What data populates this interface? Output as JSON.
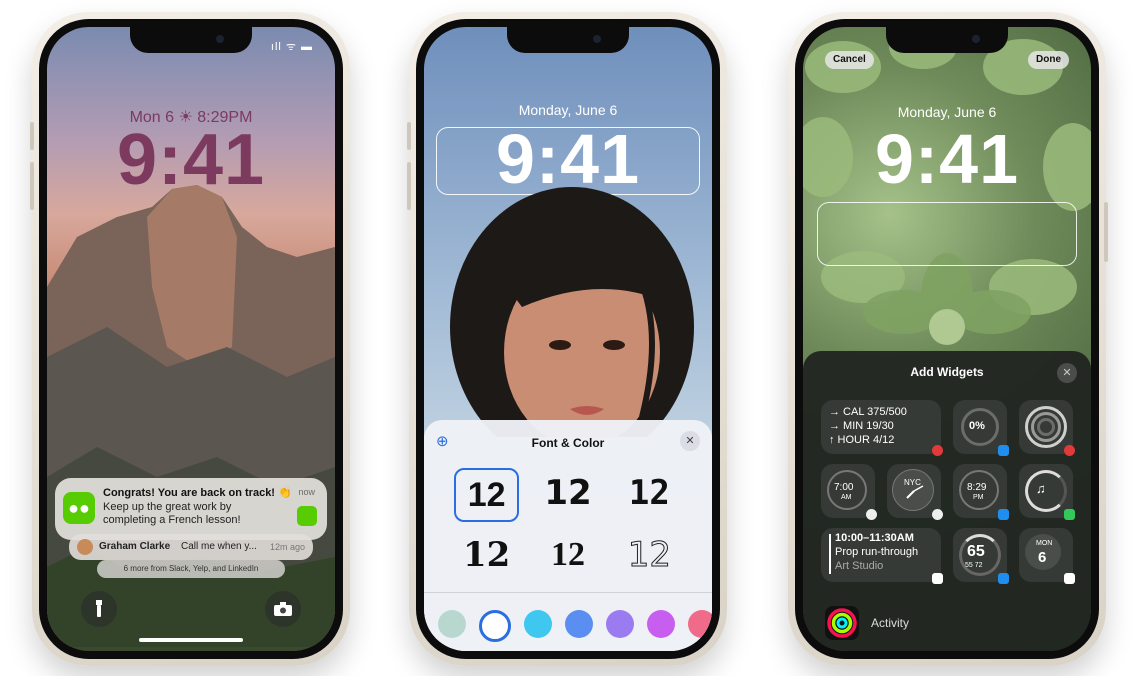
{
  "lock_screen": {
    "status": "ıll ᯤ ▬",
    "date_line": "Mon 6 ☀ 8:29PM",
    "time": "9:41",
    "notification": {
      "title": "Congrats! You are back on track! 👏",
      "body": "Keep up the great work by completing a French lesson!",
      "time": "now"
    },
    "message": {
      "sender": "Graham Clarke",
      "text": "Call me when y...",
      "time": "12m ago"
    },
    "more": "6 more from Slack, Yelp, and LinkedIn",
    "flashlight_icon": "flashlight-icon",
    "camera_icon": "camera-icon"
  },
  "font_screen": {
    "date": "Monday, June 6",
    "time": "9:41",
    "sheet_title": "Font & Color",
    "close": "✕",
    "font_options": [
      "12",
      "12",
      "12",
      "12",
      "12",
      "12"
    ],
    "selected_font_index": 0,
    "swatches": [
      "#b8d8cf",
      "#ffffff",
      "#3ec8f0",
      "#5a8ef0",
      "#9b7cf0",
      "#c85ef0",
      "#f06b8a"
    ],
    "selected_swatch_index": 1
  },
  "widget_screen": {
    "cancel": "Cancel",
    "done": "Done",
    "date": "Monday, June 6",
    "time": "9:41",
    "sheet_title": "Add Widgets",
    "close": "✕",
    "fitness": [
      "→ CAL  375/500",
      "→ MIN  19/30",
      "↑ HOUR  4/12"
    ],
    "percent": "0%",
    "clock": "7:00",
    "clock_sub": "AM",
    "world_clock": "NYC",
    "alarm": "8:29",
    "alarm_sub": "PM",
    "event": [
      "10:00–11:30AM",
      "Prop run-through",
      "Art Studio"
    ],
    "temp": "65",
    "temp_range": "55  72",
    "cal_day": "MON",
    "cal_date": "6",
    "app_name": "Activity"
  }
}
